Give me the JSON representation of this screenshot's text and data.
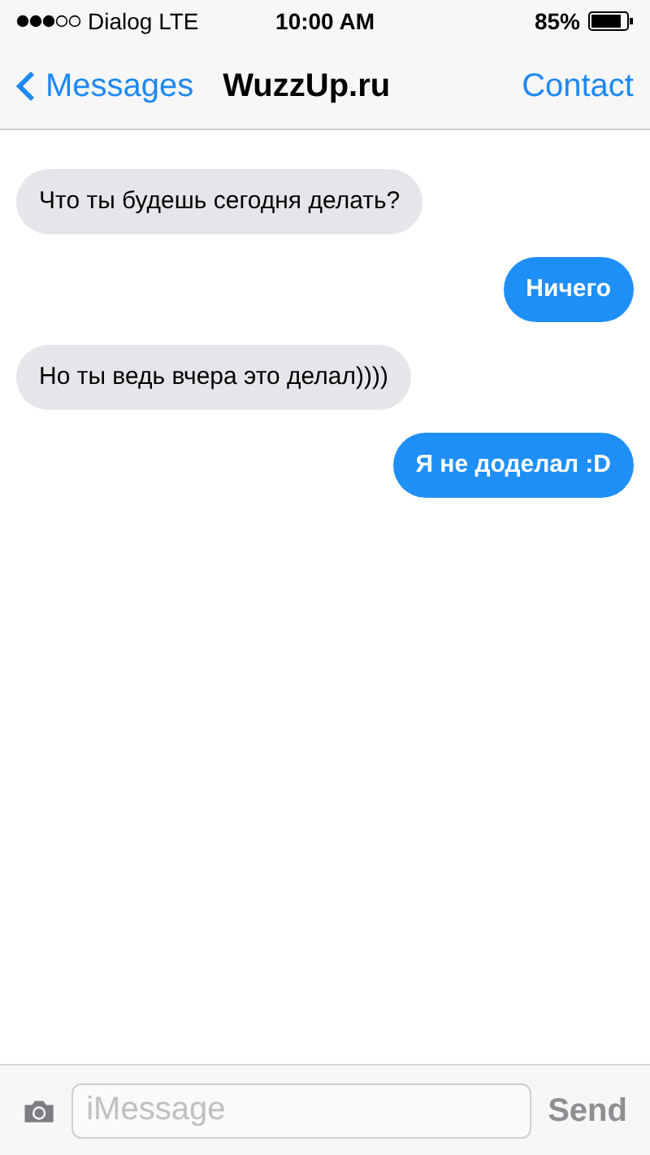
{
  "status_bar": {
    "carrier": "Dialog LTE",
    "time": "10:00 AM",
    "battery": "85%"
  },
  "nav_bar": {
    "back": "Messages",
    "title": "WuzzUp.ru",
    "action": "Contact"
  },
  "messages": [
    {
      "kind": "incoming",
      "text": "Что ты будешь сегодня делать?"
    },
    {
      "kind": "outgoing",
      "text": "Ничего"
    },
    {
      "kind": "incoming",
      "text": "Но ты ведь вчера это делал))))"
    },
    {
      "kind": "outgoing",
      "text": "Я не доделал :D"
    }
  ],
  "composer": {
    "placeholder": "iMessage",
    "send": "Send"
  }
}
